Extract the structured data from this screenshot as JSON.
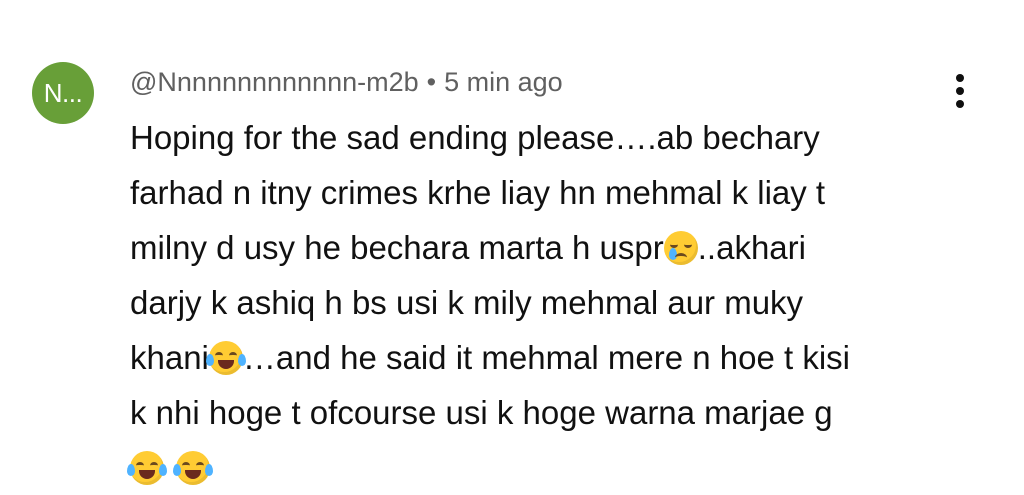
{
  "comment": {
    "avatar_text": "N...",
    "avatar_color": "#689f38",
    "author": "@Nnnnnnnnnnnnn-m2b",
    "separator": "•",
    "timestamp": "5 min ago",
    "menu_icon": "more-vert-icon",
    "lines": {
      "l1": "Hoping for the sad ending please….ab bechary",
      "l2": "farhad n itny crimes krhe liay hn mehmal k liay t",
      "l3a": "milny d usy he bechara marta h uspr",
      "l3b": "..akhari",
      "l4": "darjy k ashiq h bs usi k mily mehmal aur muky",
      "l5a": "khani",
      "l5b": "…and he said it mehmal mere n hoe t kisi",
      "l6": "k nhi hoge t ofcourse usi k hoge warna marjae g"
    },
    "emojis": [
      "crying-face-emoji",
      "tears-of-joy-emoji",
      "tears-of-joy-emoji",
      "tears-of-joy-emoji"
    ]
  }
}
